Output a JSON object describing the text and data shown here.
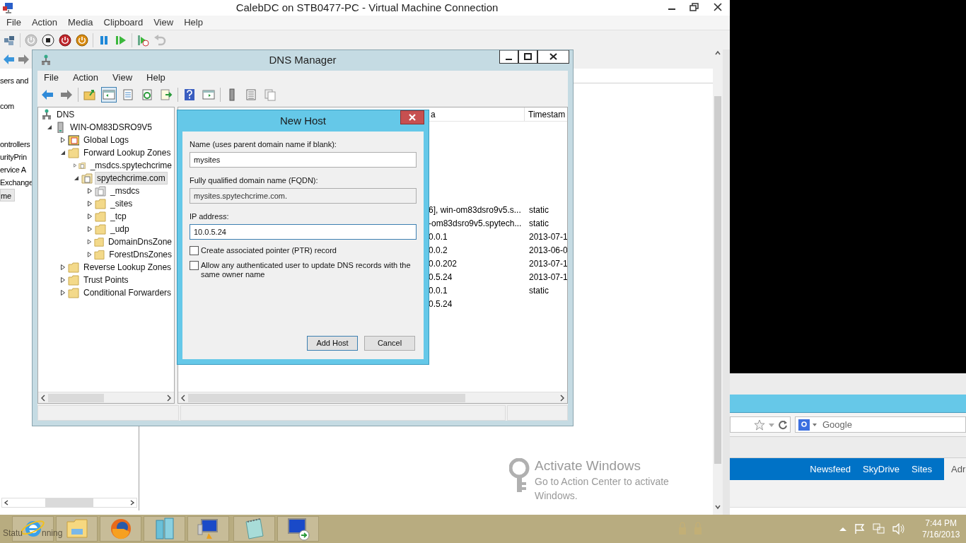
{
  "vm_window": {
    "title": "CalebDC on STB0477-PC - Virtual Machine Connection",
    "menu": [
      "File",
      "Action",
      "Media",
      "Clipboard",
      "View",
      "Help"
    ]
  },
  "background_window": {
    "pane_items": [
      {
        "label": "sers and",
        "selected": false
      },
      {
        "label": "com",
        "selected": false
      },
      {
        "label": "ontrollers",
        "selected": false
      },
      {
        "label": "urityPrin",
        "selected": false
      },
      {
        "label": "ervice A",
        "selected": false
      },
      {
        "label": "Exchange",
        "selected": false
      },
      {
        "label": "me",
        "selected": true
      }
    ]
  },
  "dns_manager": {
    "title": "DNS Manager",
    "menu": [
      "File",
      "Action",
      "View",
      "Help"
    ],
    "console_tree_pressed": true,
    "tree": [
      {
        "label": "DNS",
        "kind": "root",
        "selected": false,
        "children": [
          {
            "label": "WIN-OM83DSRO9V5",
            "kind": "server",
            "expanded": true,
            "selected": false,
            "children": [
              {
                "label": "Global Logs",
                "kind": "logs",
                "expanded": false,
                "selected": false
              },
              {
                "label": "Forward Lookup Zones",
                "kind": "folder",
                "expanded": true,
                "selected": false,
                "children": [
                  {
                    "label": "_msdcs.spytechcrime",
                    "kind": "zone",
                    "expanded": false,
                    "selected": false
                  },
                  {
                    "label": "spytechcrime.com",
                    "kind": "zone",
                    "expanded": true,
                    "selected": true,
                    "children": [
                      {
                        "label": "_msdcs",
                        "kind": "delegation",
                        "expanded": false,
                        "selected": false
                      },
                      {
                        "label": "_sites",
                        "kind": "folder",
                        "expanded": false,
                        "selected": false
                      },
                      {
                        "label": "_tcp",
                        "kind": "folder",
                        "expanded": false,
                        "selected": false
                      },
                      {
                        "label": "_udp",
                        "kind": "folder",
                        "expanded": false,
                        "selected": false
                      },
                      {
                        "label": "DomainDnsZone",
                        "kind": "folder",
                        "expanded": false,
                        "selected": false
                      },
                      {
                        "label": "ForestDnsZones",
                        "kind": "folder",
                        "expanded": false,
                        "selected": false
                      }
                    ]
                  }
                ]
              },
              {
                "label": "Reverse Lookup Zones",
                "kind": "folder",
                "expanded": false,
                "selected": false
              },
              {
                "label": "Trust Points",
                "kind": "folder",
                "expanded": false,
                "selected": false
              },
              {
                "label": "Conditional Forwarders",
                "kind": "folder",
                "expanded": false,
                "selected": false
              }
            ]
          }
        ]
      }
    ],
    "list": {
      "columns": [
        "a",
        "Timestam"
      ],
      "rows": [
        {
          "data": "6], win-om83dsro9v5.s...",
          "timestamp": "static"
        },
        {
          "data": "-om83dsro9v5.spytech...",
          "timestamp": "static"
        },
        {
          "data": "0.0.1",
          "timestamp": "2013-07-1"
        },
        {
          "data": "0.0.2",
          "timestamp": "2013-06-0"
        },
        {
          "data": "0.0.202",
          "timestamp": "2013-07-1"
        },
        {
          "data": "0.5.24",
          "timestamp": "2013-07-1"
        },
        {
          "data": "0.0.1",
          "timestamp": "static"
        },
        {
          "data": "0.5.24"
        }
      ]
    }
  },
  "new_host_dialog": {
    "title": "New Host",
    "fields": [
      {
        "label": "Name (uses parent domain name if blank):",
        "value": "mysites",
        "readonly": false,
        "focused": false
      },
      {
        "label": "Fully qualified domain name (FQDN):",
        "value": "mysites.spytechcrime.com.",
        "readonly": true,
        "focused": false
      },
      {
        "label": "IP address:",
        "value": "10.0.5.24",
        "readonly": false,
        "focused": true
      }
    ],
    "checkboxes": [
      {
        "label": "Create associated pointer (PTR) record",
        "checked": false
      },
      {
        "label": "Allow any authenticated user to update DNS records with the same owner name",
        "checked": false
      }
    ],
    "buttons": [
      {
        "label": "Add Host",
        "default": true
      },
      {
        "label": "Cancel",
        "default": false
      }
    ]
  },
  "activation_notice": {
    "title": "Activate Windows",
    "text": "Go to Action Center to activate Windows."
  },
  "browser": {
    "search_placeholder": "Google",
    "nav": [
      "Newsfeed",
      "SkyDrive",
      "Sites"
    ],
    "nav_cut": "Adr"
  },
  "taskbar": {
    "status_fragments": [
      "Statu",
      "nning"
    ],
    "time": "7:44 PM",
    "date": "7/16/2013"
  }
}
